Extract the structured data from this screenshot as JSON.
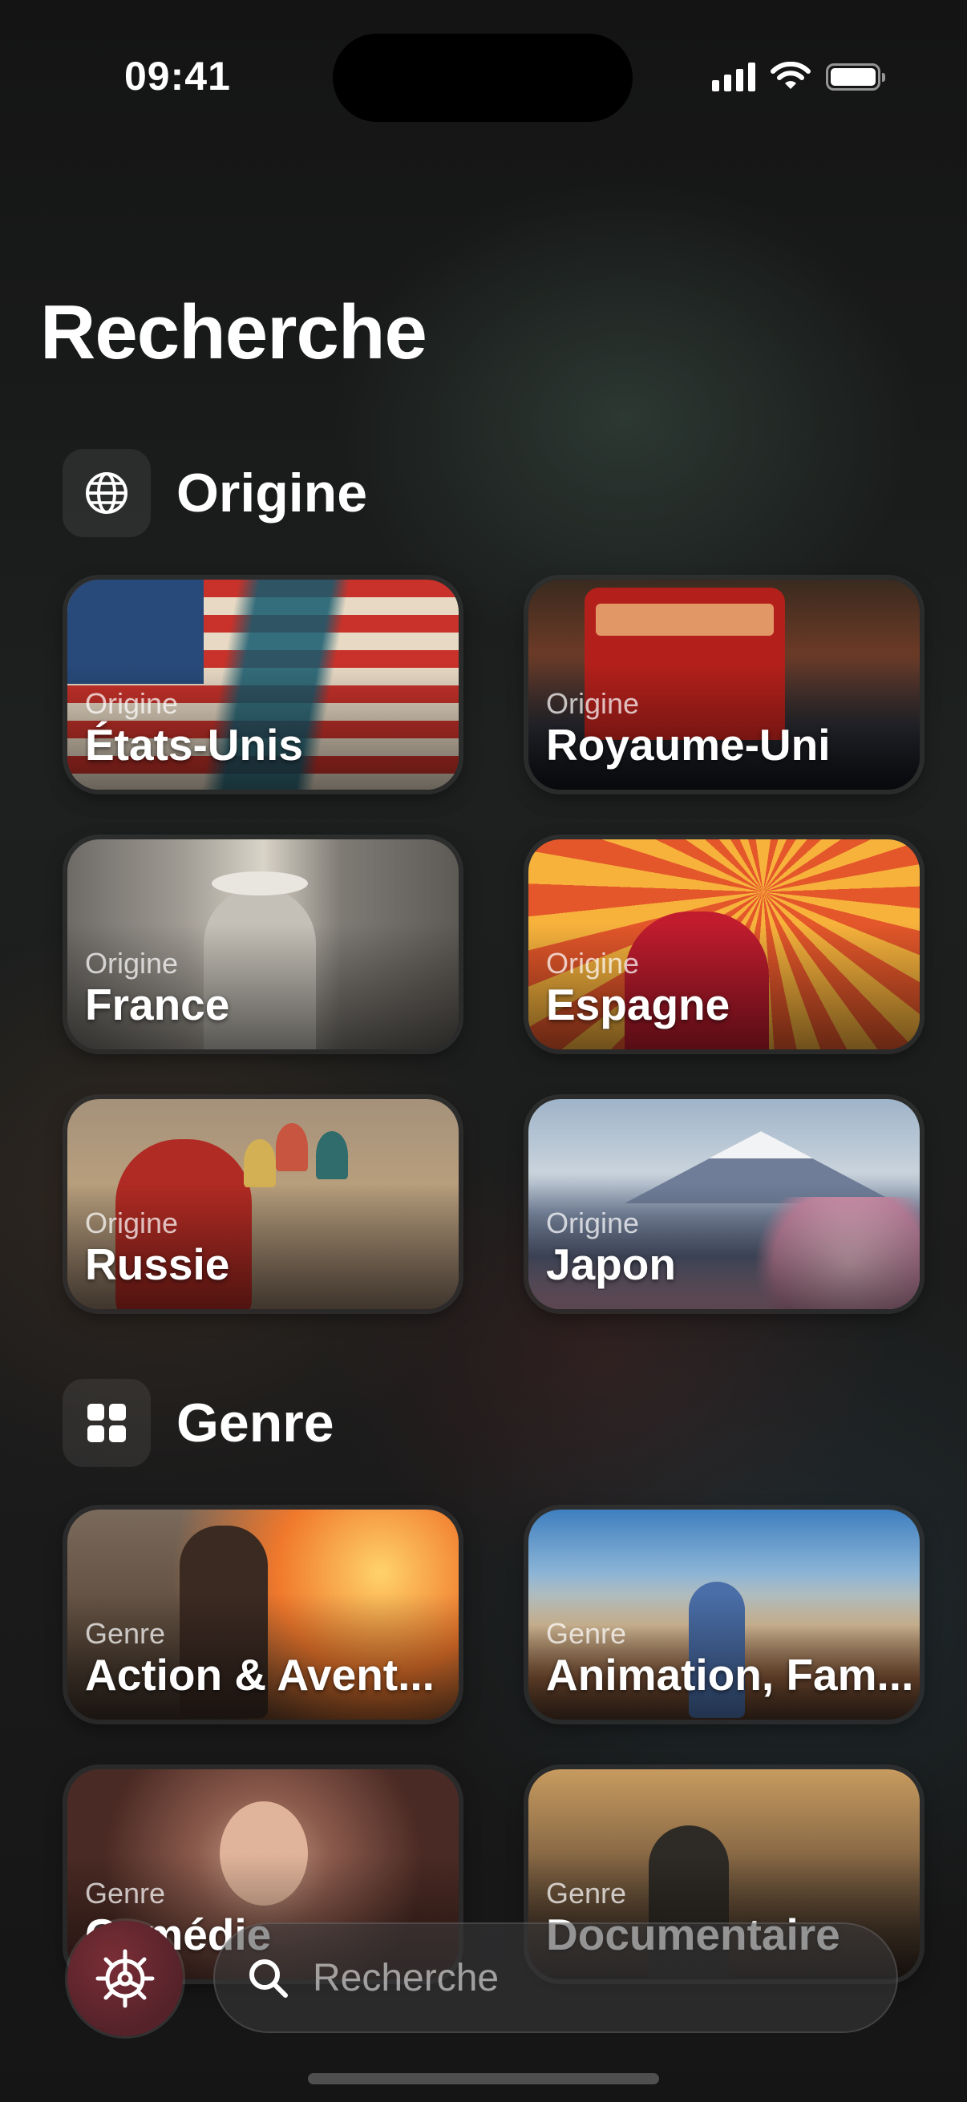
{
  "status_bar": {
    "time": "09:41",
    "icons": [
      "signal-icon",
      "wifi-icon",
      "battery-icon"
    ]
  },
  "page": {
    "title": "Recherche"
  },
  "sections": [
    {
      "title": "Origine",
      "icon": "globe-icon",
      "cards": [
        {
          "kicker": "Origine",
          "name": "États-Unis"
        },
        {
          "kicker": "Origine",
          "name": "Royaume-Uni"
        },
        {
          "kicker": "Origine",
          "name": "France"
        },
        {
          "kicker": "Origine",
          "name": "Espagne"
        },
        {
          "kicker": "Origine",
          "name": "Russie"
        },
        {
          "kicker": "Origine",
          "name": "Japon"
        }
      ]
    },
    {
      "title": "Genre",
      "icon": "grid-icon",
      "cards": [
        {
          "kicker": "Genre",
          "name": "Action & Avent..."
        },
        {
          "kicker": "Genre",
          "name": "Animation, Fam..."
        },
        {
          "kicker": "Genre",
          "name": "Comédie"
        },
        {
          "kicker": "Genre",
          "name": "Documentaire"
        }
      ]
    }
  ],
  "bottom_bar": {
    "settings_icon": "gear-icon",
    "search_placeholder": "Recherche",
    "search_icon": "search-icon"
  }
}
